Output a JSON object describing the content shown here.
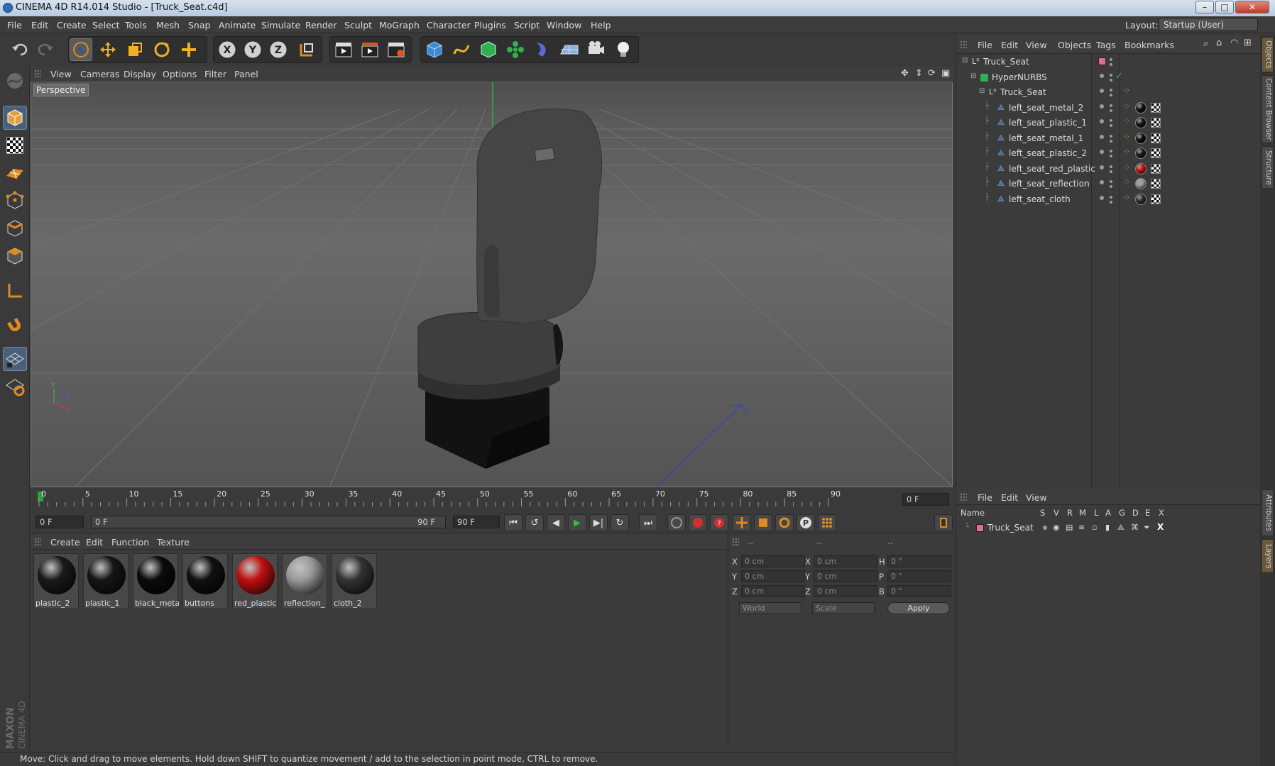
{
  "window": {
    "title": "CINEMA 4D R14.014 Studio - [Truck_Seat.c4d]",
    "minimize": "–",
    "maximize": "□",
    "close": "✕"
  },
  "menubar": {
    "items": [
      "File",
      "Edit",
      "Create",
      "Select",
      "Tools",
      "Mesh",
      "Snap",
      "Animate",
      "Simulate",
      "Render",
      "Sculpt",
      "MoGraph",
      "Character",
      "Plugins",
      "Script",
      "Window",
      "Help"
    ],
    "layout_label": "Layout:",
    "layout_value": "Startup (User)"
  },
  "toolbar": {
    "icons": [
      "undo-icon",
      "redo-icon",
      "live-select-icon",
      "move-icon",
      "scale-icon",
      "rotate-icon",
      "add-icon",
      "x-axis-icon",
      "y-axis-icon",
      "z-axis-icon",
      "coordinate-system-icon",
      "render-view-icon",
      "render-picture-viewer-icon",
      "render-settings-icon",
      "cube-icon",
      "spline-pen-icon",
      "nurbs-icon",
      "array-icon",
      "deformer-icon",
      "floor-icon",
      "camera-icon",
      "light-icon"
    ],
    "axis_labels": [
      "X",
      "Y",
      "Z"
    ]
  },
  "left_toolbar": {
    "icons": [
      "sculpt-icon",
      "model-mode-icon",
      "texture-mode-icon",
      "workplane-mode-icon",
      "points-mode-icon",
      "edges-mode-icon",
      "polygons-mode-icon",
      "axis-mode-icon",
      "magnet-icon",
      "workplane-lock-icon",
      "snap-icon"
    ],
    "brand": [
      "MAXON",
      "CINEMA 4D"
    ]
  },
  "viewport": {
    "menu": [
      "View",
      "Cameras",
      "Display",
      "Options",
      "Filter",
      "Panel"
    ],
    "label": "Perspective",
    "axis": {
      "x": "X",
      "y": "Y",
      "z": "Z"
    }
  },
  "timeline": {
    "ticks": [
      "0",
      "5",
      "10",
      "15",
      "20",
      "25",
      "30",
      "35",
      "40",
      "45",
      "50",
      "55",
      "60",
      "65",
      "70",
      "75",
      "80",
      "85",
      "90"
    ],
    "current_frame": "0 F",
    "start_field": "0 F",
    "range_start": "0 F",
    "range_end": "90 F",
    "end_field": "90 F",
    "buttons": [
      "⏮",
      "↺",
      "◀",
      "▶",
      "▶|",
      "↻",
      "⏭"
    ]
  },
  "material_manager": {
    "menu": [
      "Create",
      "Edit",
      "Function",
      "Texture"
    ],
    "materials": [
      {
        "name": "plastic_2",
        "color": "#1a1a1a"
      },
      {
        "name": "plastic_1",
        "color": "#161616"
      },
      {
        "name": "black_meta",
        "color": "#0b0b0b"
      },
      {
        "name": "buttons",
        "color": "#101010"
      },
      {
        "name": "red_plastic",
        "color": "#c01010"
      },
      {
        "name": "reflection_",
        "color": "#9a9a9a"
      },
      {
        "name": "cloth_2",
        "color": "#333333"
      }
    ]
  },
  "coordinates": {
    "headers": [
      "--",
      "--",
      "--"
    ],
    "rows": [
      {
        "a": "X",
        "av": "0 cm",
        "b": "X",
        "bv": "0 cm",
        "c": "H",
        "cv": "0 °"
      },
      {
        "a": "Y",
        "av": "0 cm",
        "b": "Y",
        "bv": "0 cm",
        "c": "P",
        "cv": "0 °"
      },
      {
        "a": "Z",
        "av": "0 cm",
        "b": "Z",
        "bv": "0 cm",
        "c": "B",
        "cv": "0 °"
      }
    ],
    "mode": "World",
    "transform": "Scale",
    "apply": "Apply"
  },
  "status": "Move: Click and drag to move elements. Hold down SHIFT to quantize movement / add to the selection in point mode, CTRL to remove.",
  "object_manager": {
    "menu": [
      "File",
      "Edit",
      "View",
      "Objects",
      "Tags",
      "Bookmarks"
    ],
    "objects": [
      {
        "name": "Truck_Seat",
        "level": 0,
        "type": "null"
      },
      {
        "name": "HyperNURBS",
        "level": 1,
        "type": "nurbs"
      },
      {
        "name": "Truck_Seat",
        "level": 2,
        "type": "null"
      },
      {
        "name": "left_seat_metal_2",
        "level": 3,
        "type": "poly",
        "mat": "#111111"
      },
      {
        "name": "left_seat_plastic_1",
        "level": 3,
        "type": "poly",
        "mat": "#111111"
      },
      {
        "name": "left_seat_metal_1",
        "level": 3,
        "type": "poly",
        "mat": "#0b0b0b"
      },
      {
        "name": "left_seat_plastic_2",
        "level": 3,
        "type": "poly",
        "mat": "#151515"
      },
      {
        "name": "left_seat_red_plastic",
        "level": 3,
        "type": "poly",
        "mat": "#c01010"
      },
      {
        "name": "left_seat_reflection",
        "level": 3,
        "type": "poly",
        "mat": "#9a9a9a"
      },
      {
        "name": "left_seat_cloth",
        "level": 3,
        "type": "poly",
        "mat": "#2a2a2a"
      }
    ]
  },
  "side_tabs": [
    "Objects",
    "Content Browser",
    "Structure"
  ],
  "side_tabs_lower": [
    "Attributes",
    "Layers"
  ],
  "layer_manager": {
    "menu": [
      "File",
      "Edit",
      "View"
    ],
    "columns": [
      "Name",
      "S",
      "V",
      "R",
      "M",
      "L",
      "A",
      "G",
      "D",
      "E",
      "X"
    ],
    "layers": [
      {
        "name": "Truck_Seat",
        "color": "#e06a9a"
      }
    ]
  },
  "colors": {
    "accent": "#4a78c2",
    "active_tool": "#4a5f7a",
    "selection": "#e06a9a"
  }
}
